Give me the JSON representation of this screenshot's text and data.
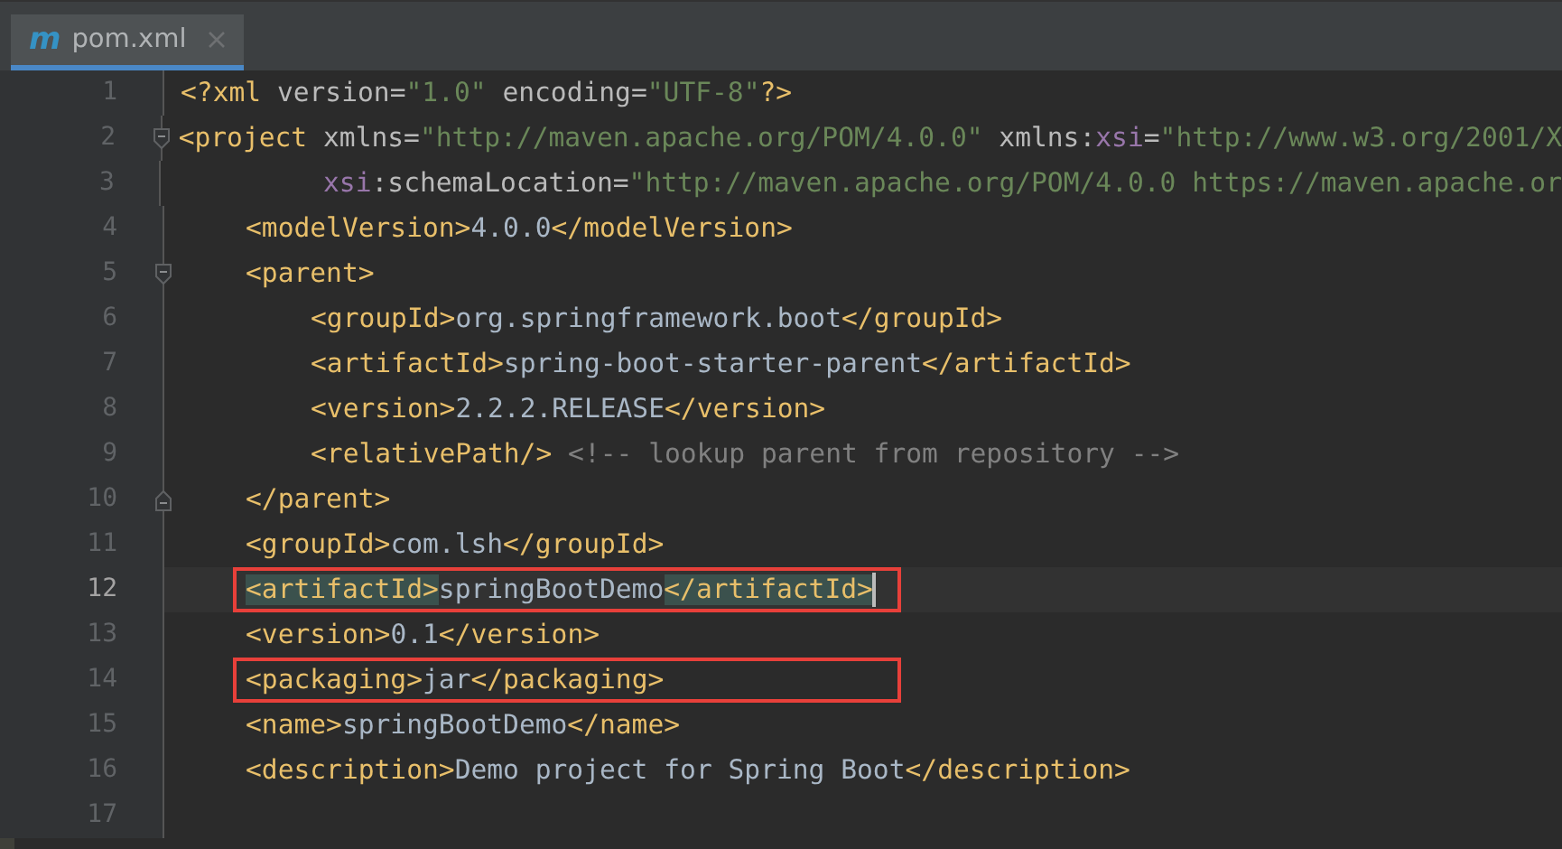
{
  "tabs": [
    {
      "icon_letter": "m",
      "label": "pom.xml",
      "selected": true
    }
  ],
  "lines": [
    {
      "number": "1",
      "continuation": false,
      "fold_open": false,
      "fold_close": false,
      "current": false,
      "annotated": false,
      "caret": false,
      "tokens": [
        {
          "kind": "tag",
          "text": "<?xml"
        },
        {
          "kind": "attr",
          "text": " version="
        },
        {
          "kind": "value",
          "text": "\"1.0\""
        },
        {
          "kind": "attr",
          "text": " encoding="
        },
        {
          "kind": "value",
          "text": "\"UTF-8\""
        },
        {
          "kind": "tag",
          "text": "?>"
        }
      ]
    },
    {
      "number": "2",
      "continuation": false,
      "fold_open": true,
      "fold_close": false,
      "current": false,
      "annotated": false,
      "caret": false,
      "tokens": [
        {
          "kind": "tag",
          "text": "<project"
        },
        {
          "kind": "attr",
          "text": " xmlns="
        },
        {
          "kind": "value",
          "text": "\"http://maven.apache.org/POM/4.0.0\""
        },
        {
          "kind": "attr",
          "text": " xmlns:"
        },
        {
          "kind": "ns",
          "text": "xsi"
        },
        {
          "kind": "attr",
          "text": "="
        },
        {
          "kind": "value",
          "text": "\"http://www.w3.org/2001/X"
        }
      ],
      "children": [
        {
          "number": "3",
          "continuation": true,
          "fold_open": false,
          "fold_close": false,
          "current": false,
          "annotated": false,
          "caret": false,
          "tokens": [
            {
              "kind": "ns",
              "text": "xsi"
            },
            {
              "kind": "attr",
              "text": ":schemaLocation="
            },
            {
              "kind": "value",
              "text": "\"http://maven.apache.org/POM/4.0.0 https://maven.apache.or"
            }
          ]
        },
        {
          "number": "4",
          "continuation": false,
          "fold_open": false,
          "fold_close": false,
          "current": false,
          "annotated": false,
          "caret": false,
          "tokens": [
            {
              "kind": "tag",
              "text": "<modelVersion>"
            },
            {
              "kind": "text",
              "text": "4.0.0"
            },
            {
              "kind": "tag",
              "text": "</modelVersion>"
            }
          ]
        },
        {
          "number": "5",
          "continuation": false,
          "fold_open": true,
          "fold_close": false,
          "current": false,
          "annotated": false,
          "caret": false,
          "tokens": [
            {
              "kind": "tag",
              "text": "<parent>"
            }
          ],
          "children": [
            {
              "number": "6",
              "continuation": false,
              "fold_open": false,
              "fold_close": false,
              "current": false,
              "annotated": false,
              "caret": false,
              "tokens": [
                {
                  "kind": "tag",
                  "text": "<groupId>"
                },
                {
                  "kind": "text",
                  "text": "org.springframework.boot"
                },
                {
                  "kind": "tag",
                  "text": "</groupId>"
                }
              ]
            },
            {
              "number": "7",
              "continuation": false,
              "fold_open": false,
              "fold_close": false,
              "current": false,
              "annotated": false,
              "caret": false,
              "tokens": [
                {
                  "kind": "tag",
                  "text": "<artifactId>"
                },
                {
                  "kind": "text",
                  "text": "spring-boot-starter-parent"
                },
                {
                  "kind": "tag",
                  "text": "</artifactId>"
                }
              ]
            },
            {
              "number": "8",
              "continuation": false,
              "fold_open": false,
              "fold_close": false,
              "current": false,
              "annotated": false,
              "caret": false,
              "tokens": [
                {
                  "kind": "tag",
                  "text": "<version>"
                },
                {
                  "kind": "text",
                  "text": "2.2.2.RELEASE"
                },
                {
                  "kind": "tag",
                  "text": "</version>"
                }
              ]
            },
            {
              "number": "9",
              "continuation": false,
              "fold_open": false,
              "fold_close": false,
              "current": false,
              "annotated": false,
              "caret": false,
              "tokens": [
                {
                  "kind": "tag",
                  "text": "<relativePath/>"
                },
                {
                  "kind": "comment",
                  "text": " <!-- lookup parent from repository -->"
                }
              ]
            }
          ]
        },
        {
          "number": "10",
          "continuation": false,
          "fold_open": false,
          "fold_close": true,
          "current": false,
          "annotated": false,
          "caret": false,
          "tokens": [
            {
              "kind": "tag",
              "text": "</parent>"
            }
          ]
        },
        {
          "number": "11",
          "continuation": false,
          "fold_open": false,
          "fold_close": false,
          "current": false,
          "annotated": false,
          "caret": false,
          "tokens": [
            {
              "kind": "tag",
              "text": "<groupId>"
            },
            {
              "kind": "text",
              "text": "com.lsh"
            },
            {
              "kind": "tag",
              "text": "</groupId>"
            }
          ]
        },
        {
          "number": "12",
          "continuation": false,
          "fold_open": false,
          "fold_close": false,
          "current": true,
          "annotated": true,
          "caret": true,
          "tokens": [
            {
              "kind": "match",
              "text": "<artifactId>"
            },
            {
              "kind": "text",
              "text": "springBootDemo"
            },
            {
              "kind": "match",
              "text": "</artifactId>"
            }
          ]
        },
        {
          "number": "13",
          "continuation": false,
          "fold_open": false,
          "fold_close": false,
          "current": false,
          "annotated": false,
          "caret": false,
          "tokens": [
            {
              "kind": "tag",
              "text": "<version>"
            },
            {
              "kind": "text",
              "text": "0.1"
            },
            {
              "kind": "tag",
              "text": "</version>"
            }
          ]
        },
        {
          "number": "14",
          "continuation": false,
          "fold_open": false,
          "fold_close": false,
          "current": false,
          "annotated": true,
          "caret": false,
          "tokens": [
            {
              "kind": "tag",
              "text": "<packaging>"
            },
            {
              "kind": "text",
              "text": "jar"
            },
            {
              "kind": "tag",
              "text": "</packaging>"
            }
          ]
        },
        {
          "number": "15",
          "continuation": false,
          "fold_open": false,
          "fold_close": false,
          "current": false,
          "annotated": false,
          "caret": false,
          "tokens": [
            {
              "kind": "tag",
              "text": "<name>"
            },
            {
              "kind": "text",
              "text": "springBootDemo"
            },
            {
              "kind": "tag",
              "text": "</name>"
            }
          ]
        },
        {
          "number": "16",
          "continuation": false,
          "fold_open": false,
          "fold_close": false,
          "current": false,
          "annotated": false,
          "caret": false,
          "tokens": [
            {
              "kind": "tag",
              "text": "<description>"
            },
            {
              "kind": "text",
              "text": "Demo project for Spring Boot"
            },
            {
              "kind": "tag",
              "text": "</description>"
            }
          ]
        }
      ]
    },
    {
      "number": "17",
      "continuation": false,
      "fold_open": false,
      "fold_close": false,
      "current": false,
      "annotated": false,
      "caret": false
    }
  ]
}
